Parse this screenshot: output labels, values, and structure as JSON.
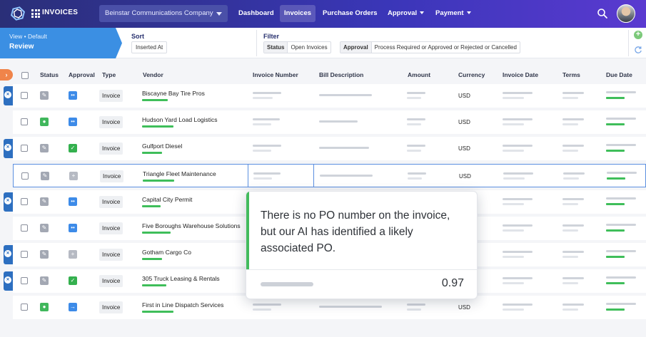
{
  "app": {
    "name": "INVOICES",
    "company": "Beinstar Communications Company"
  },
  "nav": [
    {
      "label": "Dashboard",
      "active": false,
      "dropdown": false
    },
    {
      "label": "Invoices",
      "active": true,
      "dropdown": false
    },
    {
      "label": "Purchase Orders",
      "active": false,
      "dropdown": false
    },
    {
      "label": "Approval",
      "active": false,
      "dropdown": true
    },
    {
      "label": "Payment",
      "active": false,
      "dropdown": true
    }
  ],
  "view": {
    "subtitle": "View • Default",
    "title": "Review"
  },
  "sort": {
    "label": "Sort",
    "value": "Inserted At"
  },
  "filter": {
    "label": "Filter",
    "chips": [
      {
        "key": "Status",
        "value": "Open Invoices"
      },
      {
        "key": "Approval",
        "value": "Process Required or Approved or Rejected or Cancelled"
      }
    ]
  },
  "columns": [
    "Status",
    "Approval",
    "Type",
    "Vendor",
    "Invoice Number",
    "Bill Description",
    "Amount",
    "Currency",
    "Invoice Date",
    "Terms",
    "Due Date"
  ],
  "rows": [
    {
      "type": "Invoice",
      "vendor": "Biscayne Bay Tire Pros",
      "currency": "USD",
      "status_icon": "pencil-icon",
      "approval_icon": "dots-icon"
    },
    {
      "type": "Invoice",
      "vendor": "Hudson Yard Load Logistics",
      "currency": "USD",
      "status_icon": "user-icon",
      "approval_icon": "dots-icon"
    },
    {
      "type": "Invoice",
      "vendor": "Gulfport Diesel",
      "currency": "USD",
      "status_icon": "pencil-icon",
      "approval_icon": "check-icon"
    },
    {
      "type": "Invoice",
      "vendor": "Triangle Fleet Maintenance",
      "currency": "USD",
      "status_icon": "pencil-icon",
      "approval_icon": "plus-icon"
    },
    {
      "type": "Invoice",
      "vendor": "Capital City Permit",
      "currency": "",
      "status_icon": "pencil-icon",
      "approval_icon": "dots-icon"
    },
    {
      "type": "Invoice",
      "vendor": "Five Boroughs Warehouse Solutions",
      "currency": "",
      "status_icon": "pencil-icon",
      "approval_icon": "dots-icon"
    },
    {
      "type": "Invoice",
      "vendor": "Gotham Cargo Co",
      "currency": "",
      "status_icon": "pencil-icon",
      "approval_icon": "plus-icon"
    },
    {
      "type": "Invoice",
      "vendor": "305 Truck Leasing & Rentals",
      "currency": "",
      "status_icon": "pencil-icon",
      "approval_icon": "check-icon"
    },
    {
      "type": "Invoice",
      "vendor": "First in Line Dispatch Services",
      "currency": "USD",
      "status_icon": "user-icon",
      "approval_icon": "arrow-icon"
    }
  ],
  "tooltip": {
    "message": "There is no PO number on the invoice, but our AI has identified a likely associated PO.",
    "score": "0.97"
  },
  "colors": {
    "accent": "#3b8fe3",
    "green": "#40b75c",
    "topbar": "#2a2f78"
  }
}
